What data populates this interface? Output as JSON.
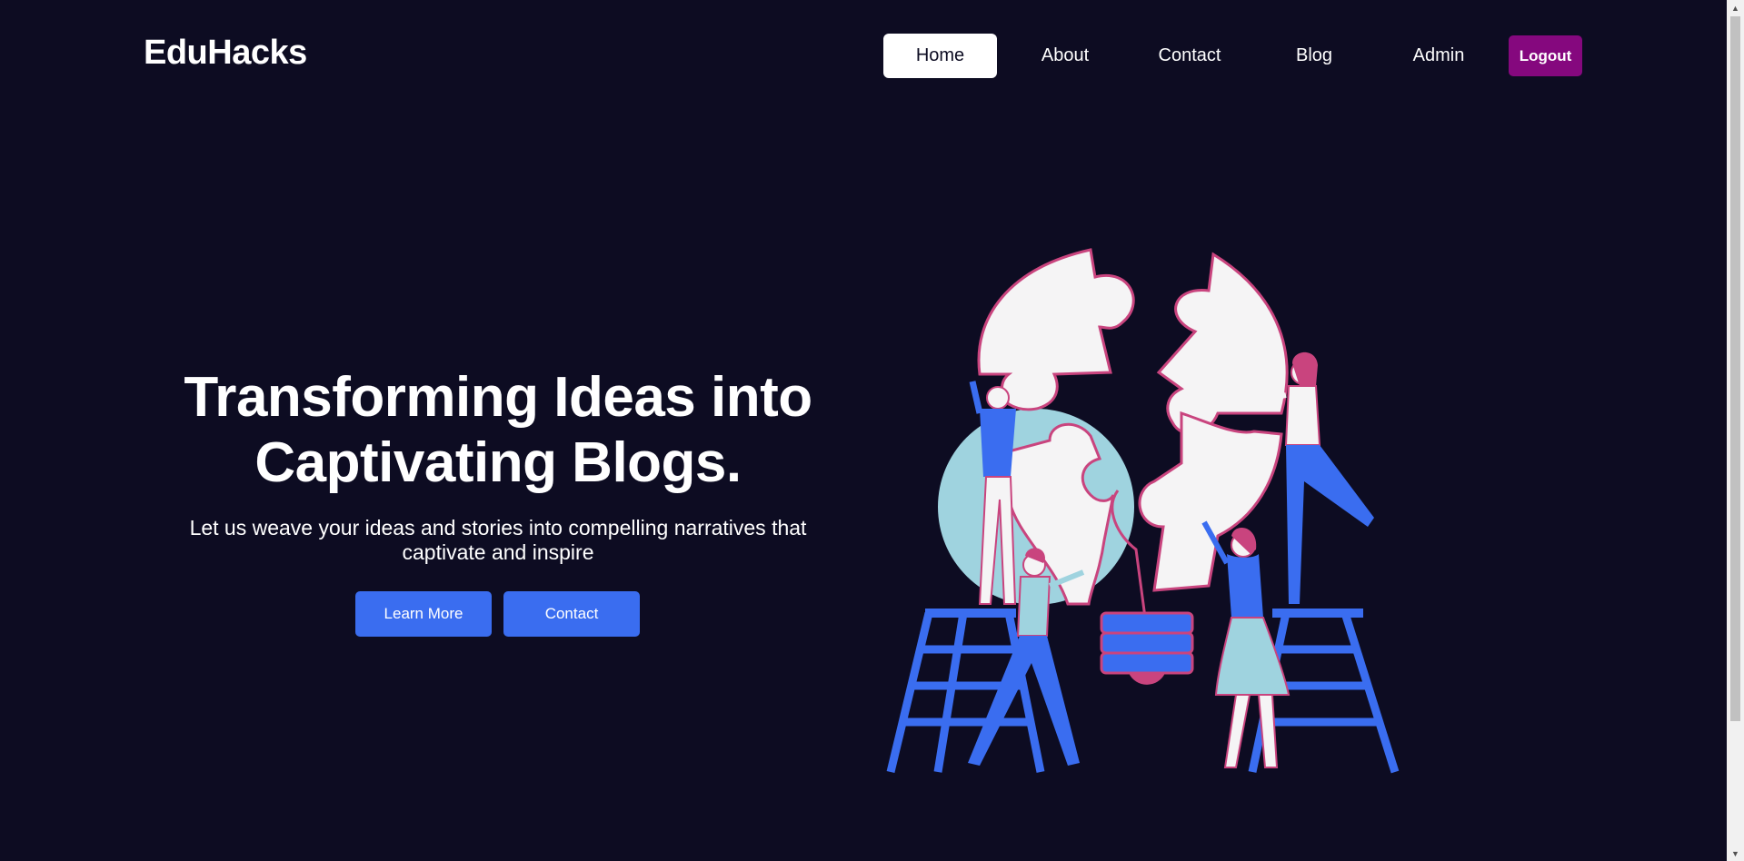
{
  "brand": {
    "logo_text": "EduHacks"
  },
  "nav": {
    "items": [
      {
        "label": "Home",
        "active": true
      },
      {
        "label": "About",
        "active": false
      },
      {
        "label": "Contact",
        "active": false
      },
      {
        "label": "Blog",
        "active": false
      },
      {
        "label": "Admin",
        "active": false
      }
    ],
    "logout_label": "Logout"
  },
  "hero": {
    "title_line1": "Transforming Ideas into",
    "title_line2": "Captivating Blogs.",
    "subtitle": "Let us weave your ideas and stories into compelling narratives that captivate and inspire",
    "learn_more_label": "Learn More",
    "contact_label": "Contact"
  },
  "illustration": {
    "icon": "puzzle-team-illustration"
  },
  "colors": {
    "background": "#0d0c22",
    "accent_blue": "#3a6df0",
    "logout_purple": "#85087e",
    "puzzle_outline": "#c9447e",
    "circle_lightblue": "#9fd3df"
  }
}
